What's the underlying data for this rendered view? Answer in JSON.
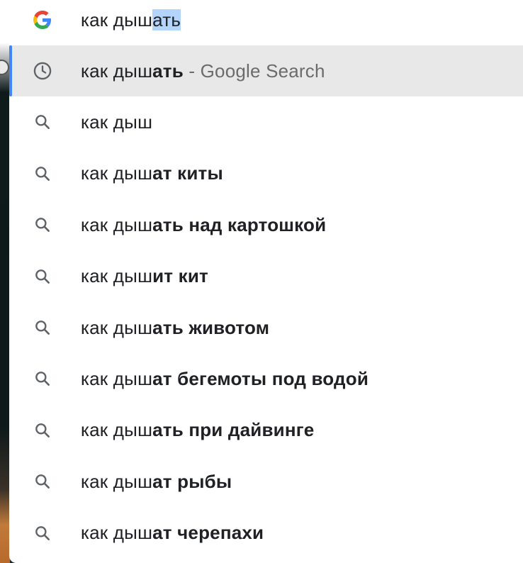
{
  "omnibox": {
    "typed_prefix": "как дыш",
    "autocompleted": "ать"
  },
  "suggestions": [
    {
      "prefix": "как дыш",
      "bold": "ать",
      "suffix": " - Google Search",
      "icon": "history-clock-icon",
      "selected": true
    },
    {
      "prefix": "как дыш",
      "bold": "",
      "suffix": "",
      "icon": "search-icon",
      "selected": false
    },
    {
      "prefix": "как дыш",
      "bold": "ат киты",
      "suffix": "",
      "icon": "search-icon",
      "selected": false
    },
    {
      "prefix": "как дыш",
      "bold": "ать над картошкой",
      "suffix": "",
      "icon": "search-icon",
      "selected": false
    },
    {
      "prefix": "как дыш",
      "bold": "ит кит",
      "suffix": "",
      "icon": "search-icon",
      "selected": false
    },
    {
      "prefix": "как дыш",
      "bold": "ать животом",
      "suffix": "",
      "icon": "search-icon",
      "selected": false
    },
    {
      "prefix": "как дыш",
      "bold": "ат бегемоты под водой",
      "suffix": "",
      "icon": "search-icon",
      "selected": false
    },
    {
      "prefix": "как дыш",
      "bold": "ать при дайвинге",
      "suffix": "",
      "icon": "search-icon",
      "selected": false
    },
    {
      "prefix": "как дыш",
      "bold": "ат рыбы",
      "suffix": "",
      "icon": "search-icon",
      "selected": false
    },
    {
      "prefix": "как дыш",
      "bold": "ат черепахи",
      "suffix": "",
      "icon": "search-icon",
      "selected": false
    }
  ],
  "colors": {
    "accent": "#4285f4",
    "selected_bg": "#e8e8e8",
    "selection_highlight": "#b3d4fc",
    "icon_gray": "#5f6368"
  }
}
